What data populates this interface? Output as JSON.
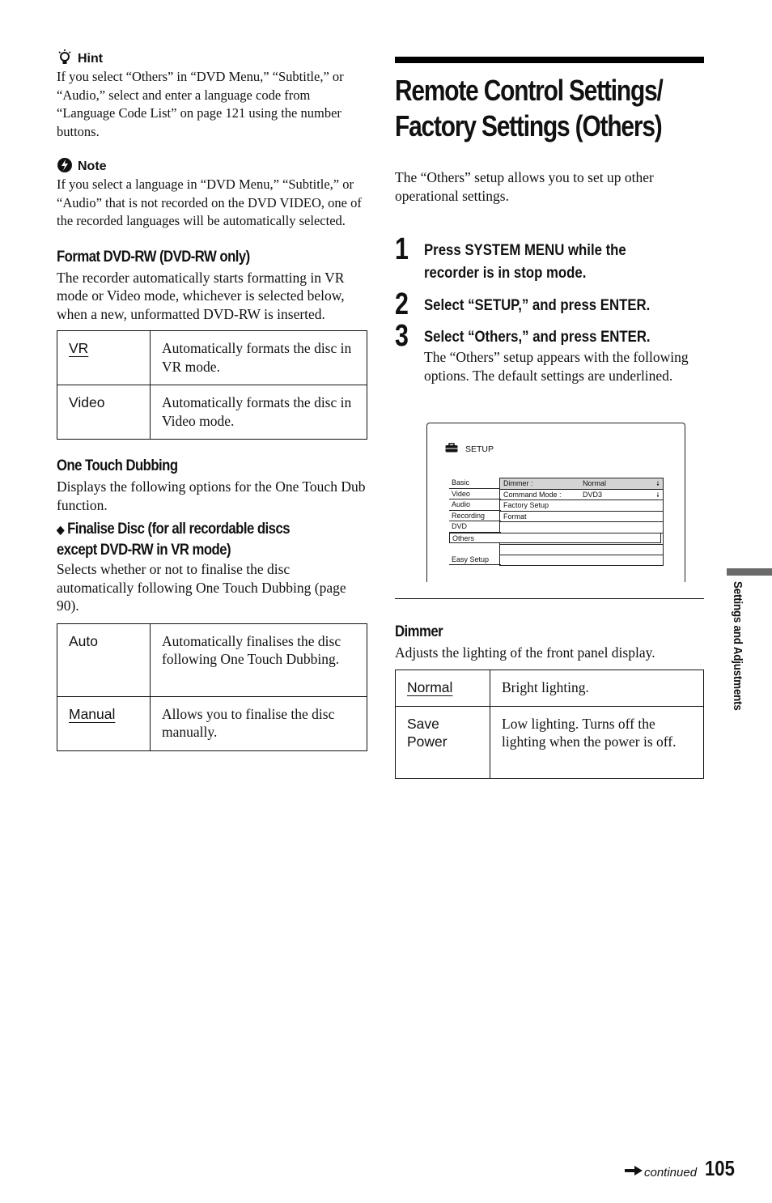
{
  "hint": {
    "icon": "lightbulb-icon",
    "label": "Hint",
    "text": "If you select “Others” in “DVD Menu,” “Subtitle,” or “Audio,” select and enter a language code from “Language Code List” on page 121 using the number buttons."
  },
  "note": {
    "icon": "note-icon",
    "label": "Note",
    "text": "If you select a language in “DVD Menu,” “Subtitle,” or “Audio” that is not recorded on the DVD VIDEO, one of the recorded languages will be automatically selected."
  },
  "format_dvdrw": {
    "heading": "Format DVD-RW (DVD-RW only)",
    "text": "The recorder automatically starts formatting in VR mode or Video mode, whichever is selected below, when a new, unformatted DVD-RW is inserted.",
    "options": [
      {
        "key": "VR",
        "desc": "Automatically formats the disc in VR mode.",
        "default": true
      },
      {
        "key": "Video",
        "desc": "Automatically formats the disc in Video mode.",
        "default": false
      }
    ]
  },
  "one_touch": {
    "heading": "One Touch Dubbing",
    "text": "Displays the following options for the One Touch Dub function.",
    "sub_bullet": "◆",
    "sub_heading_line1": "Finalise Disc (for all recordable discs",
    "sub_heading_line2": "except DVD-RW in VR mode)",
    "sub_text": "Selects whether or not to finalise the disc automatically following One Touch Dubbing (page 90).",
    "options": [
      {
        "key": "Auto",
        "desc": "Automatically finalises the disc following One Touch Dubbing.",
        "default": false
      },
      {
        "key": "Manual",
        "desc": "Allows you to finalise the disc manually.",
        "default": true
      }
    ]
  },
  "title": {
    "line1": "Remote Control Settings/",
    "line2": "Factory Settings (Others)"
  },
  "intro": "The “Others” setup allows you to set up other operational settings.",
  "steps": [
    {
      "num": "1",
      "line1": "Press SYSTEM MENU while the",
      "line2": "recorder is in stop mode."
    },
    {
      "num": "2",
      "line1": "Select “SETUP,” and press ENTER."
    },
    {
      "num": "3",
      "line1": "Select “Others,” and press ENTER.",
      "body": "The “Others” setup appears with the following options. The default settings are underlined."
    }
  ],
  "setup_screen": {
    "icon": "toolbox-icon",
    "header": "SETUP",
    "tabs": [
      "Basic",
      "Video",
      "Audio",
      "Recording",
      "DVD",
      "Others",
      "",
      "Easy Setup"
    ],
    "selected_tab": "Others",
    "rows": [
      {
        "label": "Dimmer :",
        "value": "Normal",
        "arrow": "🠗"
      },
      {
        "label": "Command Mode :",
        "value": "DVD3",
        "arrow": "🠗"
      },
      {
        "label": "Factory Setup",
        "value": "",
        "arrow": ""
      },
      {
        "label": "Format",
        "value": "",
        "arrow": ""
      },
      {
        "label": "",
        "value": "",
        "arrow": ""
      },
      {
        "label": "",
        "value": "",
        "arrow": ""
      },
      {
        "label": "",
        "value": "",
        "arrow": ""
      },
      {
        "label": "",
        "value": "",
        "arrow": ""
      }
    ]
  },
  "dimmer": {
    "heading": "Dimmer",
    "text": "Adjusts the lighting of the front panel display.",
    "options": [
      {
        "key": "Normal",
        "desc": "Bright lighting.",
        "default": true
      },
      {
        "key": "Save Power",
        "desc": "Low lighting. Turns off the lighting when the power is off.",
        "default": false
      }
    ]
  },
  "side_tab_label": "Settings and Adjustments",
  "footer": {
    "continued": "continued",
    "page_number": "105"
  }
}
